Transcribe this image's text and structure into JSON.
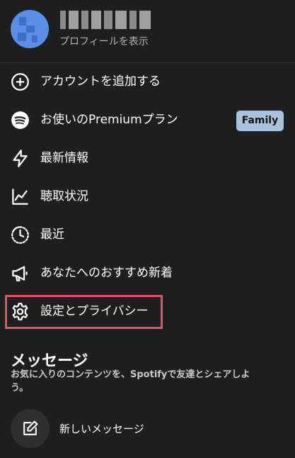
{
  "profile": {
    "view_profile_label": "プロフィールを表示"
  },
  "menu": {
    "items": [
      {
        "label": "アカウントを追加する",
        "icon": "plus-circle-icon"
      },
      {
        "label": "お使いのPremiumプラン",
        "icon": "spotify-icon",
        "badge": "Family"
      },
      {
        "label": "最新情報",
        "icon": "lightning-icon"
      },
      {
        "label": "聴取状況",
        "icon": "chart-icon"
      },
      {
        "label": "最近",
        "icon": "history-icon"
      },
      {
        "label": "あなたへのおすすめ新着",
        "icon": "megaphone-icon"
      },
      {
        "label": "設定とプライバシー",
        "icon": "gear-icon",
        "highlighted": true
      }
    ]
  },
  "messages": {
    "heading": "メッセージ",
    "description": "お気に入りのコンテンツを、Spotifyで友達とシェアしよう。",
    "new_message_label": "新しいメッセージ",
    "new_message_icon": "compose-icon"
  },
  "colors": {
    "background": "#1f1f1f",
    "badge": "#a9c3dc",
    "highlight": "#e44f6d",
    "avatar": "#5b8ee6"
  }
}
